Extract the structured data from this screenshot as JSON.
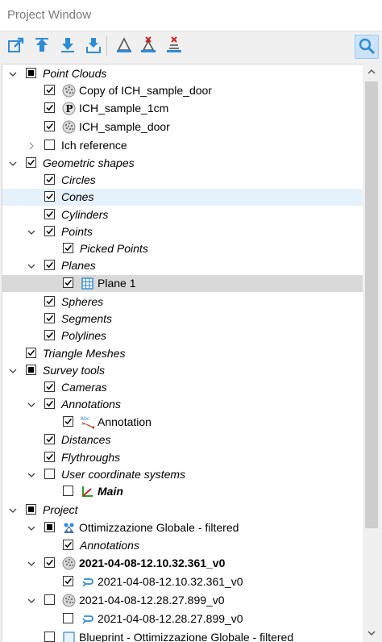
{
  "window": {
    "title": "Project Window"
  },
  "toolbar": {
    "buttons": [
      {
        "icon": "export-icon"
      },
      {
        "icon": "upload-icon"
      },
      {
        "icon": "download-icon"
      },
      {
        "icon": "download-all-icon"
      },
      {
        "icon": "measure-tool-icon"
      },
      {
        "icon": "measure-delete-icon"
      },
      {
        "icon": "measure-delete-all-icon"
      },
      {
        "icon": "search-icon"
      }
    ]
  },
  "tree": {
    "items": [
      {
        "label": "Point Clouds"
      },
      {
        "label": "Copy of ICH_sample_door"
      },
      {
        "label": "ICH_sample_1cm"
      },
      {
        "label": "ICH_sample_door"
      },
      {
        "label": "Ich reference"
      },
      {
        "label": "Geometric shapes"
      },
      {
        "label": "Circles"
      },
      {
        "label": "Cones"
      },
      {
        "label": "Cylinders"
      },
      {
        "label": "Points"
      },
      {
        "label": "Picked Points"
      },
      {
        "label": "Planes"
      },
      {
        "label": "Plane 1"
      },
      {
        "label": "Spheres"
      },
      {
        "label": "Segments"
      },
      {
        "label": "Polylines"
      },
      {
        "label": "Triangle Meshes"
      },
      {
        "label": "Survey tools"
      },
      {
        "label": "Cameras"
      },
      {
        "label": "Annotations"
      },
      {
        "label": "Annotation"
      },
      {
        "label": "Distances"
      },
      {
        "label": "Flythroughs"
      },
      {
        "label": "User coordinate systems"
      },
      {
        "label": "Main"
      },
      {
        "label": "Project"
      },
      {
        "label": "Ottimizzazione Globale - filtered"
      },
      {
        "label": "Annotations"
      },
      {
        "label": "2021-04-08-12.10.32.361_v0"
      },
      {
        "label": "2021-04-08-12.10.32.361_v0"
      },
      {
        "label": "2021-04-08-12.28.27.899_v0"
      },
      {
        "label": "2021-04-08-12.28.27.899_v0"
      },
      {
        "label": "Blueprint - Ottimizzazione Globale - filtered"
      }
    ]
  },
  "colors": {
    "accent": "#2e8bd6",
    "highlight": "#e5f1fb",
    "selected": "#d9d9d9",
    "delete_red": "#d02020"
  }
}
